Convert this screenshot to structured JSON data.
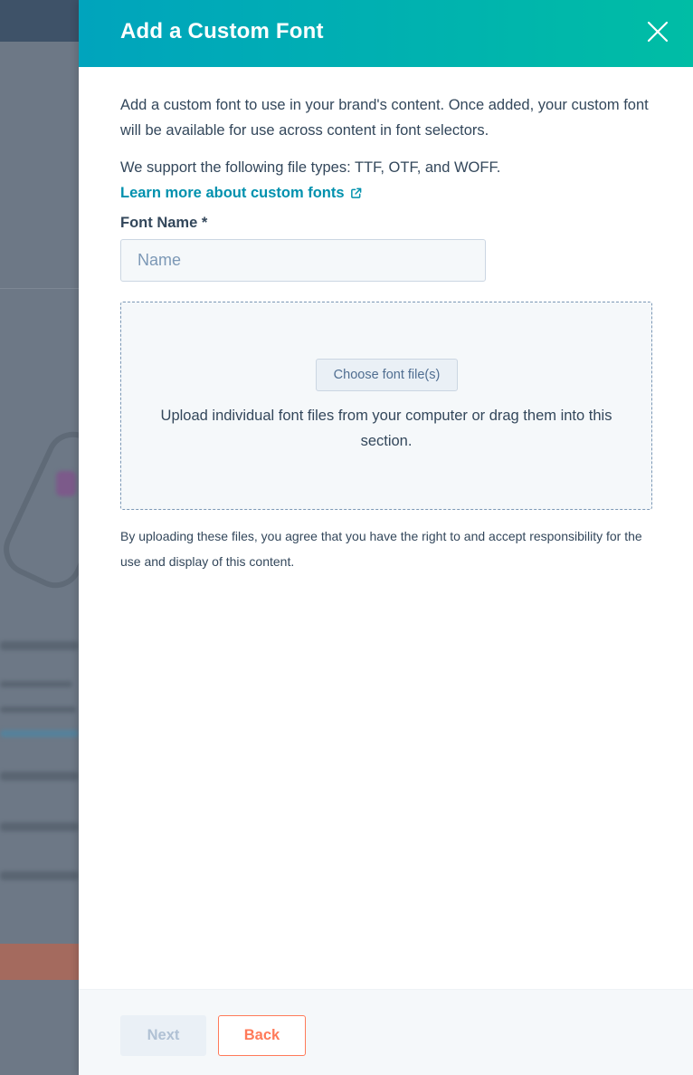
{
  "modal": {
    "title": "Add a Custom Font",
    "close_icon": "close-icon",
    "description": "Add a custom font to use in your brand's content. Once added, your custom font will be available for use across content in font selectors.",
    "supported_types": "We support the following file types: TTF, OTF, and WOFF.",
    "learn_more_link": "Learn more about custom fonts",
    "external_link_icon": "external-link-icon",
    "font_name_label": "Font Name *",
    "font_name_placeholder": "Name",
    "font_name_value": "",
    "upload": {
      "button_label": "Choose font file(s)",
      "instructions": "Upload individual font files from your computer or drag them into this section."
    },
    "disclaimer": "By uploading these files, you agree that you have the right to and accept responsibility for the use and display of this content."
  },
  "footer": {
    "next_label": "Next",
    "back_label": "Back"
  },
  "colors": {
    "header_gradient_start": "#00a4bd",
    "header_gradient_end": "#00bda5",
    "link": "#0091ae",
    "back_button": "#ff7a59",
    "text": "#33475b"
  }
}
